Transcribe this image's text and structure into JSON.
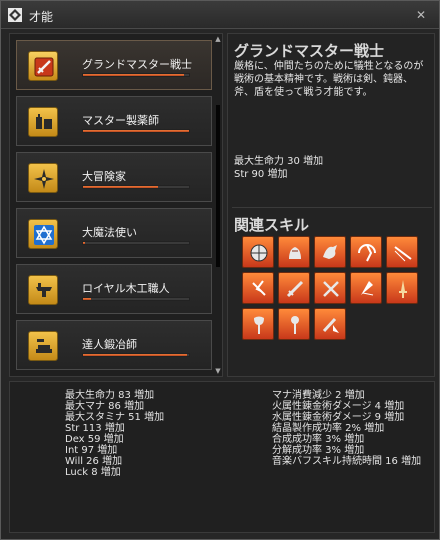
{
  "window": {
    "title": "才能"
  },
  "talents": [
    {
      "label": "グランドマスター戦士",
      "icon": "crossed-sword-icon",
      "progress": 0.95,
      "selected": true
    },
    {
      "label": "マスター製薬師",
      "icon": "alchemy-icon",
      "progress": 0.99,
      "selected": false
    },
    {
      "label": "大冒険家",
      "icon": "compass-icon",
      "progress": 0.7,
      "selected": false
    },
    {
      "label": "大魔法使い",
      "icon": "star-of-david-icon",
      "progress": 0.02,
      "selected": false
    },
    {
      "label": "ロイヤル木工職人",
      "icon": "anvil-icon",
      "progress": 0.08,
      "selected": false
    },
    {
      "label": "達人鍛冶師",
      "icon": "blacksmith-icon",
      "progress": 0.98,
      "selected": false
    }
  ],
  "detail": {
    "title": "グランドマスター戦士",
    "description": "厳格に、仲間たちのために犠牲となるのが戦術の基本精神です。戦術は剣、鈍器、斧、盾を使って戦う才能です。",
    "stats": [
      "最大生命力 30 増加",
      "Str 90 増加"
    ],
    "skills_title": "関連スキル",
    "skills": [
      "shield-skill-icon",
      "rage-skill-icon",
      "charge-skill-icon",
      "windmill-skill-icon",
      "thrust-skill-icon",
      "defense-skill-icon",
      "sword-skill-icon",
      "crossed-swords-skill-icon",
      "smash-skill-icon",
      "dagger-skill-icon",
      "axe-skill-icon",
      "mace-skill-icon",
      "counter-skill-icon"
    ]
  },
  "bonus": {
    "left": [
      "最大生命力 83 増加",
      "最大マナ 86 増加",
      "最大スタミナ 51 増加",
      "Str 113 増加",
      "Dex 59 増加",
      "Int 97 増加",
      "Will 26 増加",
      "Luck 8 増加"
    ],
    "right": [
      "マナ消費減少 2 増加",
      "火属性錬金術ダメージ 4 増加",
      "水属性錬金術ダメージ 9 増加",
      "結晶製作成功率 2% 増加",
      "合成成功率 3% 増加",
      "分解成功率 3% 増加",
      "音楽バフスキル持続時間 16 増加"
    ]
  },
  "colors": {
    "accent_bar": "#e0622a",
    "badge_gold": "#f2c24a",
    "skill_orange": "#f07a30"
  }
}
